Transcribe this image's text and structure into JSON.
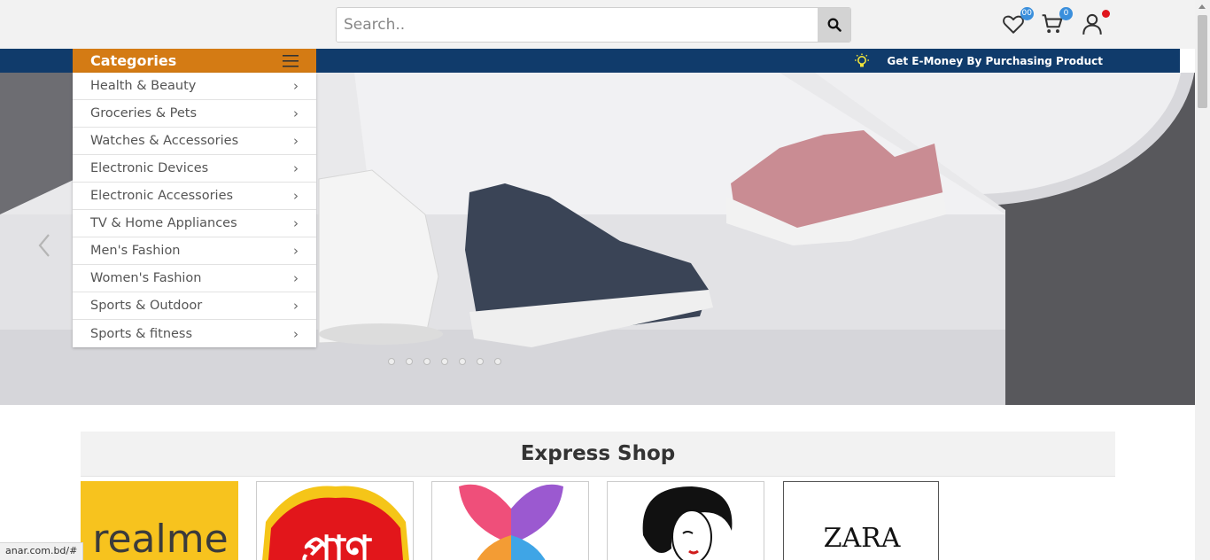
{
  "header": {
    "search_placeholder": "Search..",
    "wishlist_count": "00",
    "cart_count": "0"
  },
  "navbar": {
    "categories_label": "Categories",
    "promo_text": "Get E-Money By Purchasing Product"
  },
  "categories": [
    {
      "label": "Health & Beauty"
    },
    {
      "label": "Groceries & Pets"
    },
    {
      "label": "Watches & Accessories"
    },
    {
      "label": "Electronic Devices"
    },
    {
      "label": "Electronic Accessories"
    },
    {
      "label": "TV & Home Appliances"
    },
    {
      "label": "Men's Fashion"
    },
    {
      "label": "Women's Fashion"
    },
    {
      "label": "Sports & Outdoor"
    },
    {
      "label": "Sports & fitness"
    }
  ],
  "express_shop": {
    "title": "Express Shop",
    "brands": [
      {
        "name": "realme",
        "icon": "realme-logo"
      },
      {
        "name": "প্রাণ",
        "icon": "pran-logo"
      },
      {
        "name": "butterfly",
        "icon": "butterfly-faces-logo"
      },
      {
        "name": "woman",
        "icon": "woman-face-logo"
      },
      {
        "name": "ZARA",
        "icon": "zara-logo"
      }
    ]
  },
  "status_bar": {
    "url": "anar.com.bd/#"
  },
  "colors": {
    "category_header": "#d47b14",
    "navbar": "#103b6b",
    "badge": "#3a8fdc",
    "realme_yellow": "#f7c31e",
    "pran_red": "#e2161b"
  }
}
